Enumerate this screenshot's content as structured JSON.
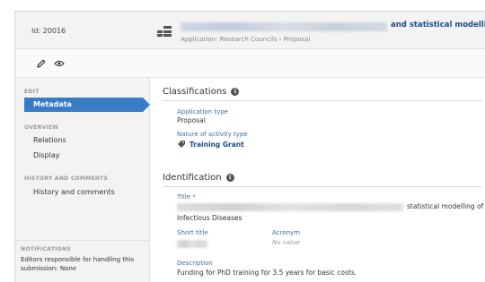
{
  "header": {
    "id_label": "Id: 20016",
    "title_visible": "and statistical modelling",
    "subtitle": "Application: Research Councils › Proposal"
  },
  "modebar": {
    "tools": [
      "pencil-icon",
      "eye-icon"
    ]
  },
  "sidebar": {
    "sections": {
      "edit": "EDIT",
      "overview": "OVERVIEW",
      "history": "HISTORY AND COMMENTS"
    },
    "items": {
      "metadata": "Metadata",
      "relations": "Relations",
      "display": "Display",
      "history": "History and comments"
    },
    "notifications": {
      "label": "NOTIFICATIONS",
      "text": "Editors responsible for handling this submission: None"
    }
  },
  "main": {
    "classifications": {
      "title": "Classifications",
      "application_type_label": "Application type",
      "application_type_value": "Proposal",
      "activity_type_label": "Nature of activity type",
      "activity_type_value": "Training Grant"
    },
    "identification": {
      "title": "Identification",
      "title_label": "Title",
      "required_mark": "*",
      "title_value_end": "statistical modelling of",
      "title_value_line2": "Infectious Diseases",
      "short_title_label": "Short title",
      "acronym_label": "Acronym",
      "acronym_value": "No value",
      "description_label": "Description",
      "description_value": "Funding for PhD training for 3.5 years for basic costs."
    }
  },
  "colors": {
    "accent": "#3a7bc8",
    "link": "#1c4c8a",
    "label": "#3a6ea5",
    "required": "#d9534f"
  }
}
